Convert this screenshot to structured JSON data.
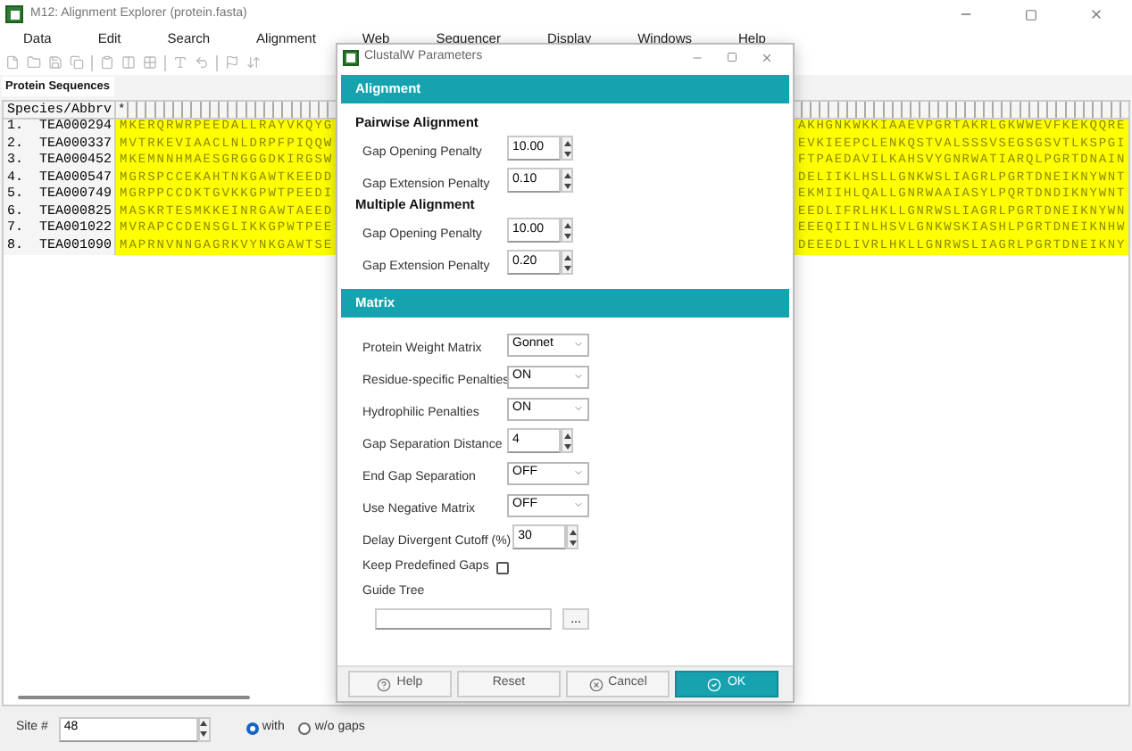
{
  "window": {
    "title": "M12: Alignment Explorer (protein.fasta)"
  },
  "menu": [
    "Data",
    "Edit",
    "Search",
    "Alignment",
    "Web",
    "Sequencer",
    "Display",
    "Windows",
    "Help"
  ],
  "tabs": [
    {
      "label": "Protein Sequences",
      "selected": true
    }
  ],
  "table": {
    "header": "Species/Abbrv",
    "marker": "*",
    "rows": [
      {
        "index": "1.",
        "name": "TEA000294",
        "left": "MKERQRWRPEEDALLRAYVKQYG",
        "right": "AKHGNKWKKIAAEVPGRTAKRLGKWWEVFKEKQQRE"
      },
      {
        "index": "2.",
        "name": "TEA000337",
        "left": "MVTRKEVIAACLNLDRPFPIQQW",
        "right": "EVKIEEPCLENKQSTVALSSSVSEGSGSVTLKSPGI"
      },
      {
        "index": "3.",
        "name": "TEA000452",
        "left": "MKEMNNHMAESGRGGGDKIRGSW",
        "right": "FTPAEDAVILKAHSVYGNRWATIARQLPGRTDNAIN"
      },
      {
        "index": "4.",
        "name": "TEA000547",
        "left": "MGRSPCCEKAHTNKGAWTKEEDD",
        "right": "DELIIKLHSLLGNKWSLIAGRLPGRTDNEIKNYWNT"
      },
      {
        "index": "5.",
        "name": "TEA000749",
        "left": "MGRPPCCDKTGVKKGPWTPEEDI",
        "right": "EKMIIHLQALLGNRWAAIASYLPQRTDNDIKNYWNT"
      },
      {
        "index": "6.",
        "name": "TEA000825",
        "left": "MASKRTESMKKEINRGAWTAEED",
        "right": "EEDLIFRLHKLLGNRWSLIAGRLPGRTDNEIKNYWN"
      },
      {
        "index": "7.",
        "name": "TEA001022",
        "left": "MVRAPCCDENSGLIKKGPWTPEE",
        "right": "EEEQIIINLHSVLGNKWSKIASHLPGRTDNEIKNHW"
      },
      {
        "index": "8.",
        "name": "TEA001090",
        "left": "MAPRNVNNGAGRKVYNKGAWTSE",
        "right": "DEEEDLIVRLHKLLGNRWSLIAGRLPGRTDNEIKNY"
      }
    ]
  },
  "status": {
    "site_label": "Site #",
    "site_value": "48",
    "radios": [
      {
        "label": "with",
        "selected": true
      },
      {
        "label": "w/o gaps",
        "selected": false
      }
    ]
  },
  "dialog": {
    "title": "ClustalW Parameters",
    "sections": [
      {
        "heading": "Alignment",
        "groups": [
          {
            "title": "Pairwise Alignment",
            "rows": [
              {
                "kind": "spin",
                "label": "Gap Opening Penalty",
                "value": "10.00"
              },
              {
                "kind": "spin",
                "label": "Gap Extension Penalty",
                "value": "0.10"
              }
            ]
          },
          {
            "title": "Multiple Alignment",
            "rows": [
              {
                "kind": "spin",
                "label": "Gap Opening Penalty",
                "value": "10.00"
              },
              {
                "kind": "spin",
                "label": "Gap Extension Penalty",
                "value": "0.20"
              }
            ]
          }
        ]
      },
      {
        "heading": "Matrix",
        "groups": [
          {
            "rows": [
              {
                "kind": "select",
                "label": "Protein Weight Matrix",
                "value": "Gonnet"
              },
              {
                "kind": "select",
                "label": "Residue-specific Penalties",
                "value": "ON"
              },
              {
                "kind": "select",
                "label": "Hydrophilic Penalties",
                "value": "ON"
              },
              {
                "kind": "spin",
                "label": "Gap Separation Distance",
                "value": "4"
              },
              {
                "kind": "select",
                "label": "End Gap Separation",
                "value": "OFF"
              },
              {
                "kind": "select",
                "label": "Use Negative Matrix",
                "value": "OFF"
              },
              {
                "kind": "spin",
                "label": "Delay Divergent Cutoff (%)",
                "value": "30"
              },
              {
                "kind": "checkbox",
                "label": "Keep Predefined Gaps",
                "checked": false
              },
              {
                "kind": "file",
                "label": "Guide Tree",
                "button": "..."
              }
            ]
          }
        ]
      }
    ],
    "buttons": [
      {
        "kind": "help",
        "label": "Help",
        "primary": false
      },
      {
        "kind": "plain",
        "label": "Reset",
        "primary": false
      },
      {
        "kind": "cancel",
        "label": "Cancel",
        "primary": false
      },
      {
        "kind": "ok",
        "label": "OK",
        "primary": true
      }
    ]
  }
}
